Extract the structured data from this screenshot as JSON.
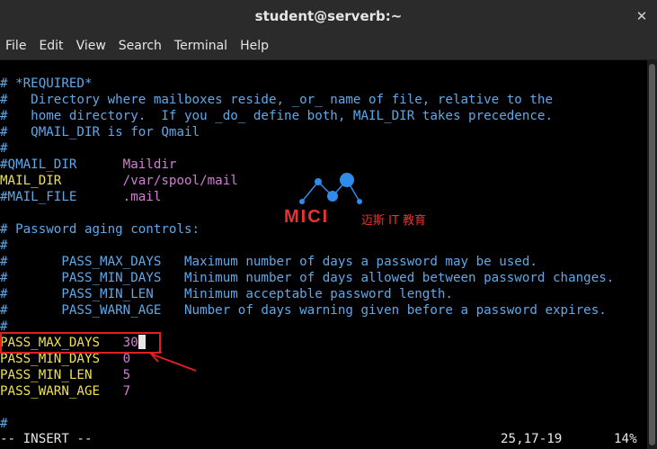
{
  "window": {
    "title": "student@serverb:~"
  },
  "menu": [
    "File",
    "Edit",
    "View",
    "Search",
    "Terminal",
    "Help"
  ],
  "lines": [
    {
      "text": "# *REQUIRED*",
      "style": "comment"
    },
    {
      "text": "#   Directory where mailboxes reside, _or_ name of file, relative to the",
      "style": "comment"
    },
    {
      "text": "#   home directory.  If you _do_ define both, MAIL_DIR takes precedence.",
      "style": "comment"
    },
    {
      "text": "#   QMAIL_DIR is for Qmail",
      "style": "comment"
    },
    {
      "text": "#",
      "style": "comment"
    },
    {
      "key": "#QMAIL_DIR      ",
      "key_style": "comment",
      "val": "Maildir",
      "val_style": "value"
    },
    {
      "key": "MAIL_DIR        ",
      "key_style": "keyword",
      "val": "/var/spool/mail",
      "val_style": "value"
    },
    {
      "key": "#MAIL_FILE      ",
      "key_style": "comment",
      "val": ".mail",
      "val_style": "value"
    },
    {
      "text": "",
      "style": "comment"
    },
    {
      "text": "# Password aging controls:",
      "style": "comment"
    },
    {
      "text": "#",
      "style": "comment"
    },
    {
      "text": "#       PASS_MAX_DAYS   Maximum number of days a password may be used.",
      "style": "comment"
    },
    {
      "text": "#       PASS_MIN_DAYS   Minimum number of days allowed between password changes.",
      "style": "comment"
    },
    {
      "text": "#       PASS_MIN_LEN    Minimum acceptable password length.",
      "style": "comment"
    },
    {
      "text": "#       PASS_WARN_AGE   Number of days warning given before a password expires.",
      "style": "comment"
    },
    {
      "text": "#",
      "style": "comment"
    },
    {
      "key": "PASS_MAX_DAYS   ",
      "key_style": "keyword",
      "val": "30",
      "val_style": "value",
      "cursor": true
    },
    {
      "key": "PASS_MIN_DAYS   ",
      "key_style": "keyword",
      "val": "0",
      "val_style": "value"
    },
    {
      "key": "PASS_MIN_LEN    ",
      "key_style": "keyword",
      "val": "5",
      "val_style": "value"
    },
    {
      "key": "PASS_WARN_AGE   ",
      "key_style": "keyword",
      "val": "7",
      "val_style": "value"
    },
    {
      "text": "",
      "style": "comment"
    },
    {
      "text": "#",
      "style": "comment"
    }
  ],
  "status": {
    "mode": "-- INSERT --",
    "position": "25,17-19",
    "percent": "14%"
  },
  "watermark": {
    "brand": "MICI",
    "sub": "迈斯 IT 教育"
  },
  "colors": {
    "comment": "#5fa8e8",
    "keyword": "#f0e04a",
    "value": "#d27ed2",
    "annotation": "#e02020"
  }
}
